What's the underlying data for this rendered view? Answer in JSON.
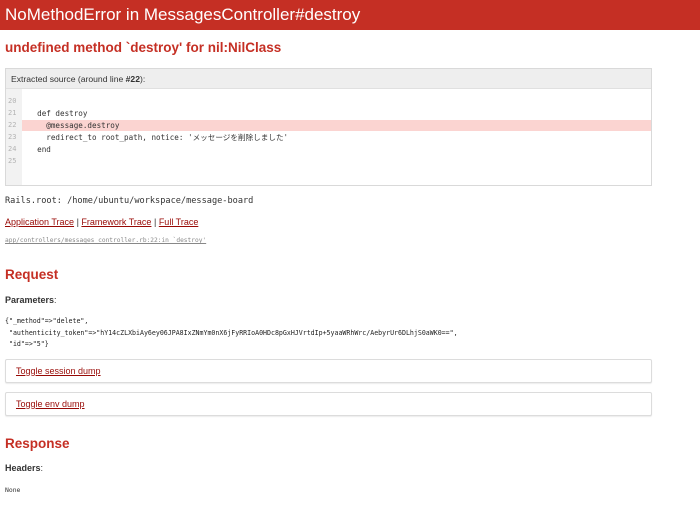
{
  "header": {
    "title": "NoMethodError in MessagesController#destroy"
  },
  "error": {
    "message": "undefined method `destroy' for nil:NilClass"
  },
  "source": {
    "info_prefix": "Extracted source (around line ",
    "info_line": "#22",
    "info_suffix": "):",
    "lines": [
      {
        "num": "20",
        "code": ""
      },
      {
        "num": "21",
        "code": "  def destroy"
      },
      {
        "num": "22",
        "code": "    @message.destroy"
      },
      {
        "num": "23",
        "code": "    redirect_to root_path, notice: 'メッセージを削除しました'"
      },
      {
        "num": "24",
        "code": "  end"
      },
      {
        "num": "25",
        "code": ""
      }
    ]
  },
  "rails_root": "Rails.root: /home/ubuntu/workspace/message-board",
  "traces": {
    "application": "Application Trace",
    "framework": "Framework Trace",
    "full": "Full Trace",
    "separator": "|",
    "path": "app/controllers/messages_controller.rb:22:in `destroy'"
  },
  "request": {
    "heading": "Request",
    "params_label": "Parameters",
    "params_lines": [
      "{\"_method\"=>\"delete\",",
      " \"authenticity_token\"=>\"hY14cZLXbiAy6ey06JPA8IxZNmYm0nX6jFyRRIoA0HDc8pGxHJVrtdIp+5yaaWRhWrc/AebyrUr6DLhjS0aWK0==\",",
      " \"id\"=>\"5\"}"
    ],
    "toggle_session": "Toggle session dump",
    "toggle_env": "Toggle env dump"
  },
  "response": {
    "heading": "Response",
    "headers_label": "Headers",
    "headers_value": "None"
  }
}
